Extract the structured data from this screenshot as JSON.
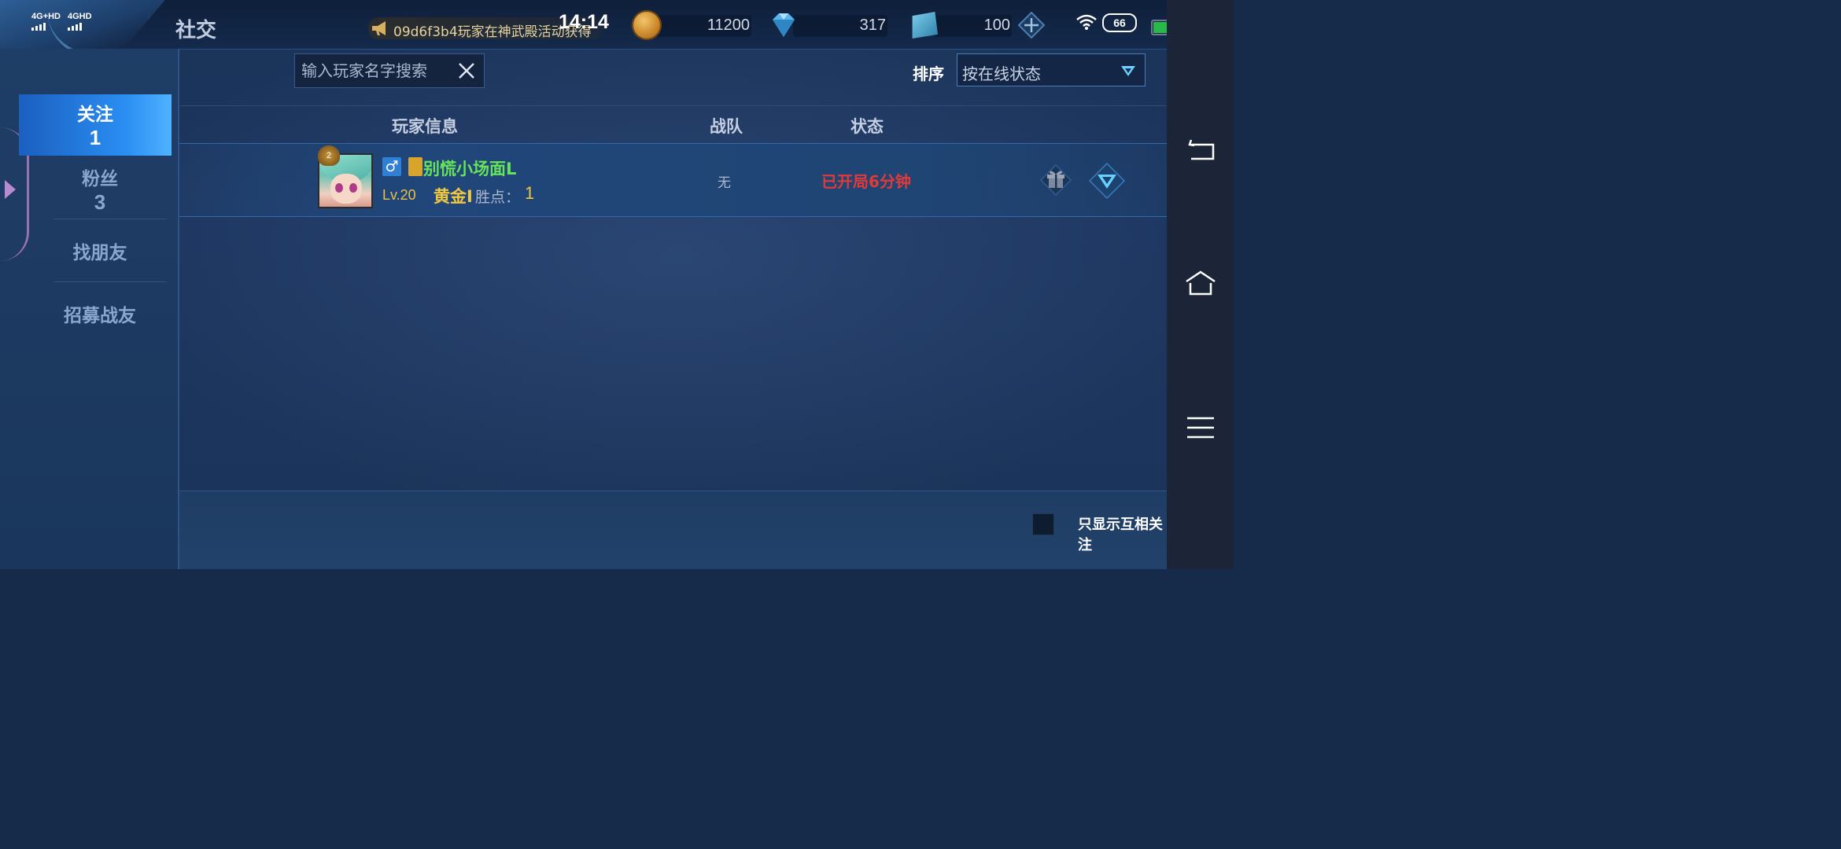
{
  "status_bar": {
    "signal1": "4G+HD",
    "signal2": "4GHD",
    "time": "14:14",
    "battery_badge": "66"
  },
  "header": {
    "title": "社交",
    "marquee_text": "09d6f3b4玩家在神武殿活动获得",
    "currencies": [
      {
        "icon": "gold-coin-icon",
        "value": "11200"
      },
      {
        "icon": "diamond-icon",
        "value": "317"
      },
      {
        "icon": "ticket-icon",
        "value": "100"
      }
    ]
  },
  "sidebar": {
    "items": [
      {
        "label": "关注",
        "count": "1"
      },
      {
        "label": "粉丝",
        "count": "3"
      },
      {
        "label": "找朋友"
      },
      {
        "label": "招募战友"
      }
    ]
  },
  "search": {
    "placeholder": "输入玩家名字搜索"
  },
  "sort": {
    "label": "排序",
    "value": "按在线状态"
  },
  "table": {
    "headers": [
      "玩家信息",
      "战队",
      "状态"
    ],
    "rows": [
      {
        "rank_badge": "2",
        "name": "别慌小场面L",
        "level": "Lv.20",
        "tier": "黄金I",
        "points_label": "胜点：",
        "points": "1",
        "team": "无",
        "status": "已开局6分钟"
      }
    ]
  },
  "footer": {
    "mutual_label": "只显示互相关注"
  },
  "colors": {
    "accent_blue": "#2a8ef2",
    "name_green": "#66e35a",
    "status_red": "#e2393a",
    "gold_text": "#f1c741"
  }
}
